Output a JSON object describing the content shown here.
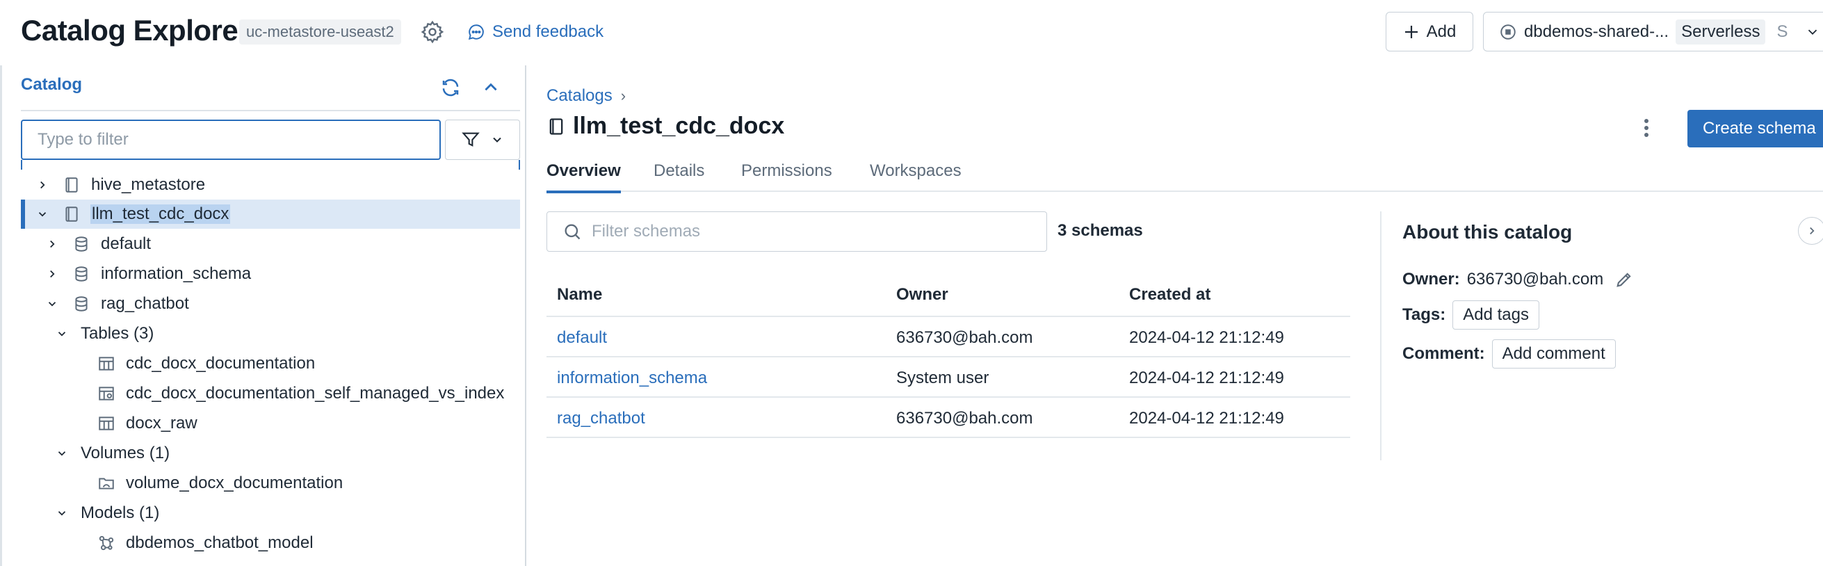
{
  "header": {
    "title": "Catalog Explorer",
    "metastore": "uc-metastore-useast2",
    "feedback": "Send feedback",
    "add_label": "Add",
    "compute_name": "dbdemos-shared-...",
    "compute_type": "Serverless",
    "compute_suffix": "S"
  },
  "sidebar": {
    "title": "Catalog",
    "filter_placeholder": "Type to filter",
    "tree": {
      "hive": "hive_metastore",
      "llm": "llm_test_cdc_docx",
      "default": "default",
      "info": "information_schema",
      "rag": "rag_chatbot",
      "tables_label": "Tables",
      "tables_count": "(3)",
      "table1": "cdc_docx_documentation",
      "table2": "cdc_docx_documentation_self_managed_vs_index",
      "table3": "docx_raw",
      "volumes_label": "Volumes",
      "volumes_count": "(1)",
      "volume1": "volume_docx_documentation",
      "models_label": "Models",
      "models_count": "(1)",
      "model1": "dbdemos_chatbot_model"
    }
  },
  "main": {
    "breadcrumb": "Catalogs",
    "breadcrumb_sep": "›",
    "catalog_name": "llm_test_cdc_docx",
    "create_label": "Create schema",
    "tabs": [
      "Overview",
      "Details",
      "Permissions",
      "Workspaces"
    ],
    "filter_placeholder": "Filter schemas",
    "schema_count": "3 schemas",
    "columns": [
      "Name",
      "Owner",
      "Created at"
    ],
    "rows": [
      {
        "name": "default",
        "owner": "636730@bah.com",
        "created": "2024-04-12 21:12:49"
      },
      {
        "name": "information_schema",
        "owner": "System user",
        "created": "2024-04-12 21:12:49"
      },
      {
        "name": "rag_chatbot",
        "owner": "636730@bah.com",
        "created": "2024-04-12 21:12:49"
      }
    ]
  },
  "about": {
    "title": "About this catalog",
    "owner_label": "Owner:",
    "owner_value": "636730@bah.com",
    "tags_label": "Tags:",
    "tags_button": "Add tags",
    "comment_label": "Comment:",
    "comment_button": "Add comment"
  },
  "colors": {
    "accent": "#2a6ebb",
    "selected_bg": "#dce8f6",
    "border": "#c8d0d8"
  }
}
